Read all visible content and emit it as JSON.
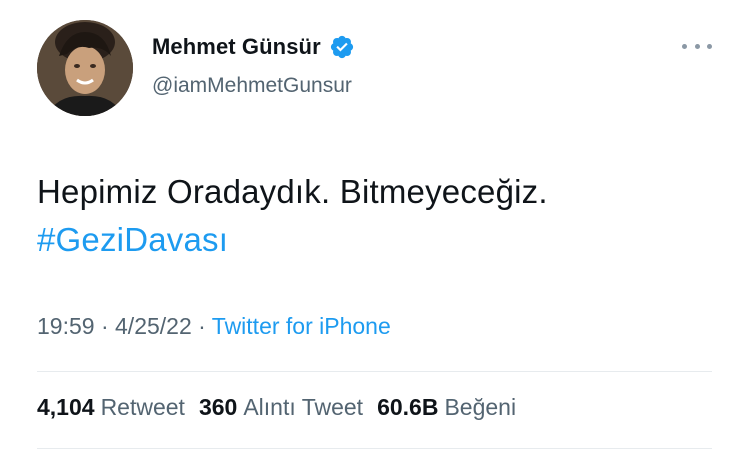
{
  "author": {
    "display_name": "Mehmet Günsür",
    "handle": "@iamMehmetGunsur",
    "verified": true,
    "verified_icon": "verified-badge-icon",
    "avatar_icon": "profile-avatar"
  },
  "more_icon": "more-horizontal-icon",
  "tweet": {
    "text": "Hepimiz Oradaydık. Bitmeyeceğiz.",
    "hashtag": "#GeziDavası"
  },
  "meta": {
    "time": "19:59",
    "separator1": " · ",
    "date": "4/25/22",
    "separator2": " · ",
    "source": "Twitter for iPhone"
  },
  "stats": {
    "retweets": {
      "count": "4,104",
      "label": "Retweet"
    },
    "quotes": {
      "count": "360",
      "label": "Alıntı Tweet"
    },
    "likes": {
      "count": "60.6B",
      "label": "Beğeni"
    }
  },
  "colors": {
    "accent": "#1d9bf0",
    "text_primary": "#0f1419",
    "text_secondary": "#536471",
    "divider": "#e7ebee"
  }
}
